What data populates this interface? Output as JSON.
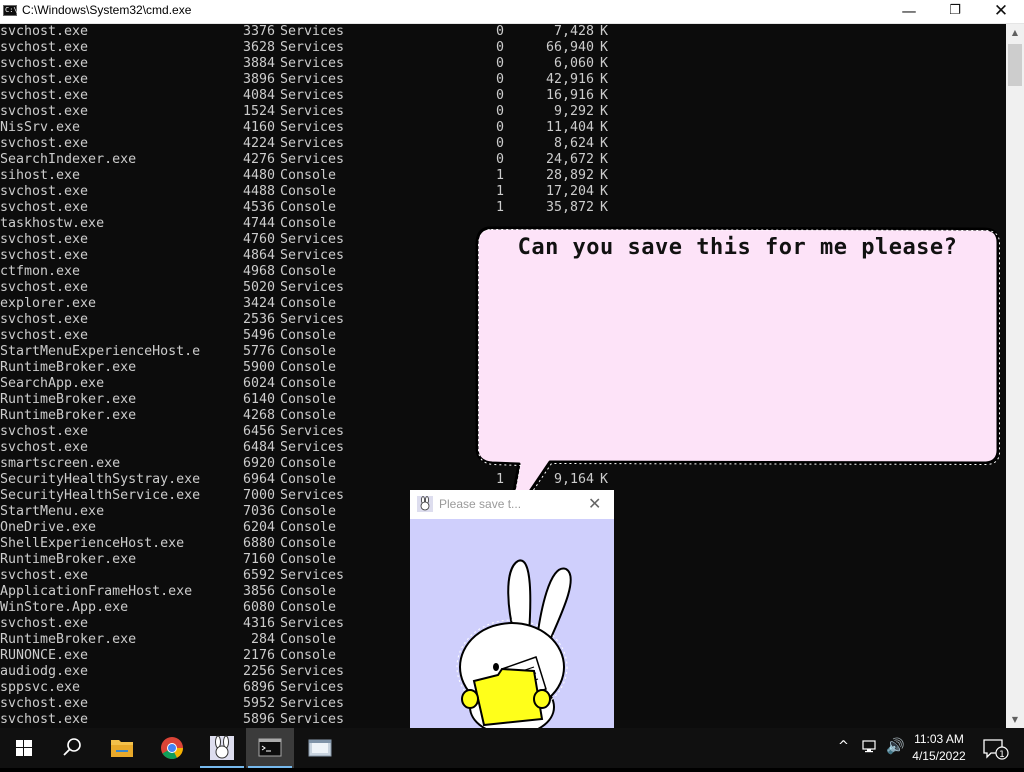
{
  "window": {
    "title": "C:\\Windows\\System32\\cmd.exe",
    "icon_label": "C:\\",
    "min_glyph": "—",
    "max_glyph": "❐",
    "close_glyph": "✕"
  },
  "console": {
    "rows": [
      {
        "name": "svchost.exe",
        "pid": "3376",
        "session": "Services",
        "num": "0",
        "mem": "7,428",
        "unit": "K"
      },
      {
        "name": "svchost.exe",
        "pid": "3628",
        "session": "Services",
        "num": "0",
        "mem": "66,940",
        "unit": "K"
      },
      {
        "name": "svchost.exe",
        "pid": "3884",
        "session": "Services",
        "num": "0",
        "mem": "6,060",
        "unit": "K"
      },
      {
        "name": "svchost.exe",
        "pid": "3896",
        "session": "Services",
        "num": "0",
        "mem": "42,916",
        "unit": "K"
      },
      {
        "name": "svchost.exe",
        "pid": "4084",
        "session": "Services",
        "num": "0",
        "mem": "16,916",
        "unit": "K"
      },
      {
        "name": "svchost.exe",
        "pid": "1524",
        "session": "Services",
        "num": "0",
        "mem": "9,292",
        "unit": "K"
      },
      {
        "name": "NisSrv.exe",
        "pid": "4160",
        "session": "Services",
        "num": "0",
        "mem": "11,404",
        "unit": "K"
      },
      {
        "name": "svchost.exe",
        "pid": "4224",
        "session": "Services",
        "num": "0",
        "mem": "8,624",
        "unit": "K"
      },
      {
        "name": "SearchIndexer.exe",
        "pid": "4276",
        "session": "Services",
        "num": "0",
        "mem": "24,672",
        "unit": "K"
      },
      {
        "name": "sihost.exe",
        "pid": "4480",
        "session": "Console",
        "num": "1",
        "mem": "28,892",
        "unit": "K"
      },
      {
        "name": "svchost.exe",
        "pid": "4488",
        "session": "Console",
        "num": "1",
        "mem": "17,204",
        "unit": "K"
      },
      {
        "name": "svchost.exe",
        "pid": "4536",
        "session": "Console",
        "num": "1",
        "mem": "35,872",
        "unit": "K"
      },
      {
        "name": "taskhostw.exe",
        "pid": "4744",
        "session": "Console",
        "num": "",
        "mem": "",
        "unit": ""
      },
      {
        "name": "svchost.exe",
        "pid": "4760",
        "session": "Services",
        "num": "",
        "mem": "",
        "unit": ""
      },
      {
        "name": "svchost.exe",
        "pid": "4864",
        "session": "Services",
        "num": "",
        "mem": "",
        "unit": ""
      },
      {
        "name": "ctfmon.exe",
        "pid": "4968",
        "session": "Console",
        "num": "",
        "mem": "",
        "unit": ""
      },
      {
        "name": "svchost.exe",
        "pid": "5020",
        "session": "Services",
        "num": "",
        "mem": "",
        "unit": ""
      },
      {
        "name": "explorer.exe",
        "pid": "3424",
        "session": "Console",
        "num": "",
        "mem": "",
        "unit": ""
      },
      {
        "name": "svchost.exe",
        "pid": "2536",
        "session": "Services",
        "num": "",
        "mem": "",
        "unit": ""
      },
      {
        "name": "svchost.exe",
        "pid": "5496",
        "session": "Console",
        "num": "",
        "mem": "",
        "unit": ""
      },
      {
        "name": "StartMenuExperienceHost.e",
        "pid": "5776",
        "session": "Console",
        "num": "",
        "mem": "",
        "unit": ""
      },
      {
        "name": "RuntimeBroker.exe",
        "pid": "5900",
        "session": "Console",
        "num": "",
        "mem": "",
        "unit": ""
      },
      {
        "name": "SearchApp.exe",
        "pid": "6024",
        "session": "Console",
        "num": "",
        "mem": "",
        "unit": ""
      },
      {
        "name": "RuntimeBroker.exe",
        "pid": "6140",
        "session": "Console",
        "num": "",
        "mem": "",
        "unit": ""
      },
      {
        "name": "RuntimeBroker.exe",
        "pid": "4268",
        "session": "Console",
        "num": "",
        "mem": "",
        "unit": ""
      },
      {
        "name": "svchost.exe",
        "pid": "6456",
        "session": "Services",
        "num": "",
        "mem": "",
        "unit": ""
      },
      {
        "name": "svchost.exe",
        "pid": "6484",
        "session": "Services",
        "num": "",
        "mem": "",
        "unit": ""
      },
      {
        "name": "smartscreen.exe",
        "pid": "6920",
        "session": "Console",
        "num": "",
        "mem": "",
        "unit": ""
      },
      {
        "name": "SecurityHealthSystray.exe",
        "pid": "6964",
        "session": "Console",
        "num": "1",
        "mem": "9,164",
        "unit": "K"
      },
      {
        "name": "SecurityHealthService.exe",
        "pid": "7000",
        "session": "Services",
        "num": "",
        "mem": "",
        "unit": ""
      },
      {
        "name": "StartMenu.exe",
        "pid": "7036",
        "session": "Console",
        "num": "",
        "mem": "",
        "unit": ""
      },
      {
        "name": "OneDrive.exe",
        "pid": "6204",
        "session": "Console",
        "num": "",
        "mem": "",
        "unit": ""
      },
      {
        "name": "ShellExperienceHost.exe",
        "pid": "6880",
        "session": "Console",
        "num": "",
        "mem": "",
        "unit": ""
      },
      {
        "name": "RuntimeBroker.exe",
        "pid": "7160",
        "session": "Console",
        "num": "",
        "mem": "",
        "unit": ""
      },
      {
        "name": "svchost.exe",
        "pid": "6592",
        "session": "Services",
        "num": "",
        "mem": "",
        "unit": ""
      },
      {
        "name": "ApplicationFrameHost.exe",
        "pid": "3856",
        "session": "Console",
        "num": "",
        "mem": "",
        "unit": ""
      },
      {
        "name": "WinStore.App.exe",
        "pid": "6080",
        "session": "Console",
        "num": "",
        "mem": "",
        "unit": ""
      },
      {
        "name": "svchost.exe",
        "pid": "4316",
        "session": "Services",
        "num": "",
        "mem": "",
        "unit": ""
      },
      {
        "name": "RuntimeBroker.exe",
        "pid": "284",
        "session": "Console",
        "num": "",
        "mem": "",
        "unit": ""
      },
      {
        "name": "RUNONCE.exe",
        "pid": "2176",
        "session": "Console",
        "num": "",
        "mem": "",
        "unit": ""
      },
      {
        "name": "audiodg.exe",
        "pid": "2256",
        "session": "Services",
        "num": "",
        "mem": "",
        "unit": ""
      },
      {
        "name": "sppsvc.exe",
        "pid": "6896",
        "session": "Services",
        "num": "",
        "mem": "",
        "unit": ""
      },
      {
        "name": "svchost.exe",
        "pid": "5952",
        "session": "Services",
        "num": "",
        "mem": "",
        "unit": ""
      },
      {
        "name": "svchost.exe",
        "pid": "5896",
        "session": "Services",
        "num": "",
        "mem": "",
        "unit": ""
      }
    ]
  },
  "bubble": {
    "text": "Can you save this for me please?",
    "fill_color": "#fde3f8",
    "outline_color": "#000000"
  },
  "popup": {
    "title": "Please save t...",
    "close_glyph": "✕",
    "body_color": "#cfcffc",
    "folder_color": "#ffff1a"
  },
  "taskbar": {
    "items": [
      "start-icon",
      "search-icon",
      "file-explorer-icon",
      "chrome-icon",
      "bunny-app-icon",
      "cmd-icon",
      "app-window-icon"
    ],
    "chevron_glyph": "^",
    "volume_glyph": "🔊",
    "time": "11:03 AM",
    "date": "4/15/2022",
    "notification_count": "1"
  }
}
